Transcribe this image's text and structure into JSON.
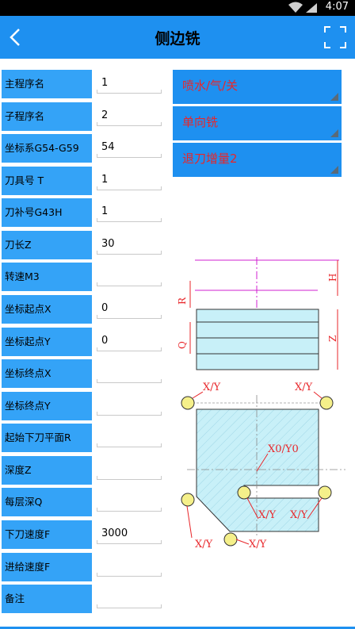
{
  "status": {
    "time": "4:07"
  },
  "header": {
    "title": "侧边铣"
  },
  "fields": [
    {
      "label": "主程序名",
      "value": "1"
    },
    {
      "label": "子程序名",
      "value": "2"
    },
    {
      "label": "坐标系G54-G59",
      "value": "54"
    },
    {
      "label": "刀具号 T",
      "value": "1"
    },
    {
      "label": "刀补号G43H",
      "value": "1"
    },
    {
      "label": "刀长Z",
      "value": "30"
    },
    {
      "label": "转速M3",
      "value": ""
    },
    {
      "label": "坐标起点X",
      "value": "0"
    },
    {
      "label": "坐标起点Y",
      "value": "0"
    },
    {
      "label": "坐标终点X",
      "value": ""
    },
    {
      "label": "坐标终点Y",
      "value": ""
    },
    {
      "label": "起始下刀平面R",
      "value": ""
    },
    {
      "label": "深度Z",
      "value": ""
    },
    {
      "label": "每层深Q",
      "value": ""
    },
    {
      "label": "下刀速度F",
      "value": "3000"
    },
    {
      "label": "进给速度F",
      "value": ""
    },
    {
      "label": "备注",
      "value": ""
    }
  ],
  "spinners": [
    {
      "selected": "喷水/气/关"
    },
    {
      "selected": "单向铣"
    },
    {
      "selected": "退刀增量2"
    }
  ],
  "diagram": {
    "labels": {
      "h": "H",
      "r": "R",
      "q": "Q",
      "z": "Z",
      "xy": "X/Y",
      "x0y0": "X0/Y0"
    }
  },
  "colors": {
    "accent": "#1e90f0",
    "label_bg": "#34a3f7",
    "option_text": "#e8262a",
    "dim_red": "#e8262a",
    "magenta": "#d020d0",
    "part_fill": "#c8f0f8",
    "hole_fill": "#f5f08a"
  }
}
